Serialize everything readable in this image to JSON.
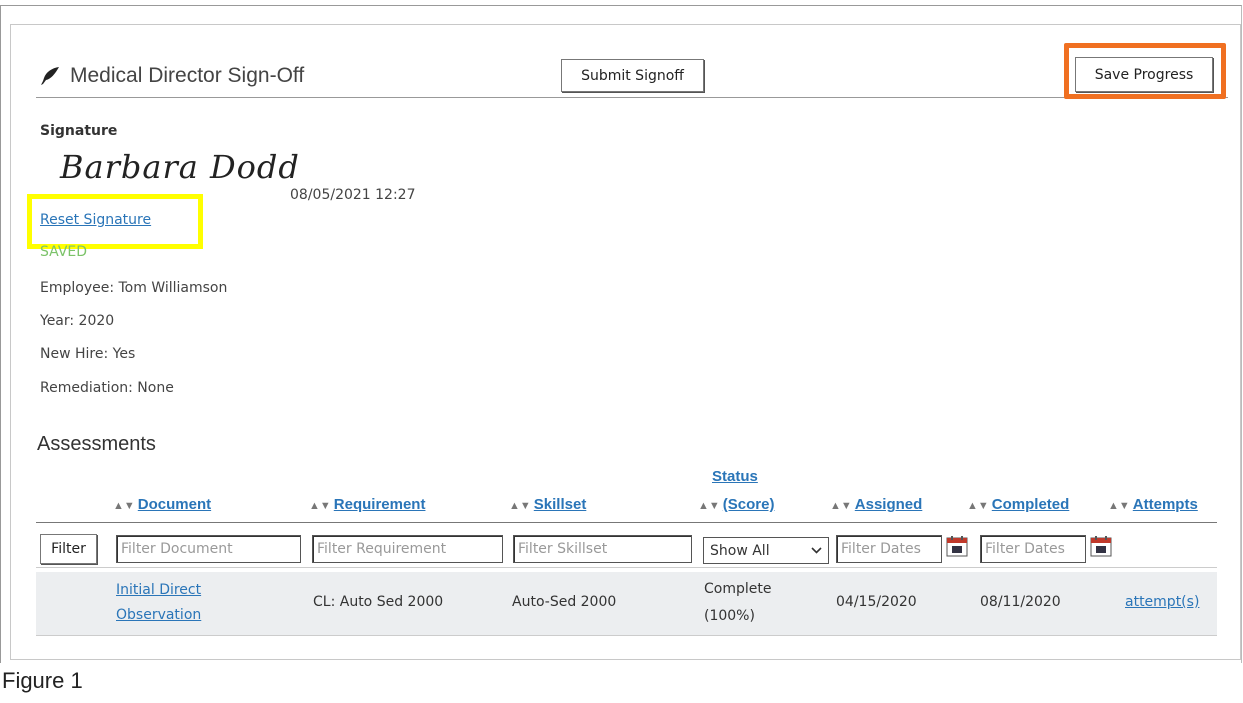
{
  "header": {
    "title": "Medical Director Sign-Off",
    "submit_label": "Submit Signoff",
    "save_label": "Save Progress"
  },
  "signature": {
    "label": "Signature",
    "name": "Barbara Dodd",
    "datetime": "08/05/2021 12:27",
    "reset_label": "Reset Signature",
    "status": "SAVED"
  },
  "info": {
    "employee": "Employee: Tom Williamson",
    "year": "Year: 2020",
    "new_hire": "New Hire: Yes",
    "remediation": "Remediation: None"
  },
  "assessments": {
    "title": "Assessments",
    "columns": {
      "document": "Document",
      "requirement": "Requirement",
      "skillset": "Skillset",
      "status_line1": "Status",
      "status_line2": "(Score)",
      "assigned": "Assigned",
      "completed": "Completed",
      "attempts": "Attempts"
    },
    "filter_button": "Filter",
    "filters": {
      "document": "Filter Document",
      "requirement": "Filter Requirement",
      "skillset": "Filter Skillset",
      "status_selected": "Show All",
      "assigned": "Filter Dates",
      "completed": "Filter Dates"
    },
    "rows": [
      {
        "document_line1": "Initial Direct",
        "document_line2": "Observation",
        "requirement": "CL: Auto Sed 2000",
        "skillset": "Auto-Sed 2000",
        "status_line1": "Complete",
        "status_line2": "(100%)",
        "assigned": "04/15/2020",
        "completed": "08/11/2020",
        "attempts": "attempt(s)"
      }
    ]
  },
  "caption": "Figure 1",
  "colors": {
    "link": "#2a75b8",
    "saved": "#7cc36a",
    "highlight_orange": "#f07021",
    "highlight_yellow": "#ffff00",
    "row_bg": "#eceef0"
  },
  "icons": {
    "title": "feather-icon",
    "date_picker": "calendar-icon",
    "select": "chevron-down-icon"
  }
}
